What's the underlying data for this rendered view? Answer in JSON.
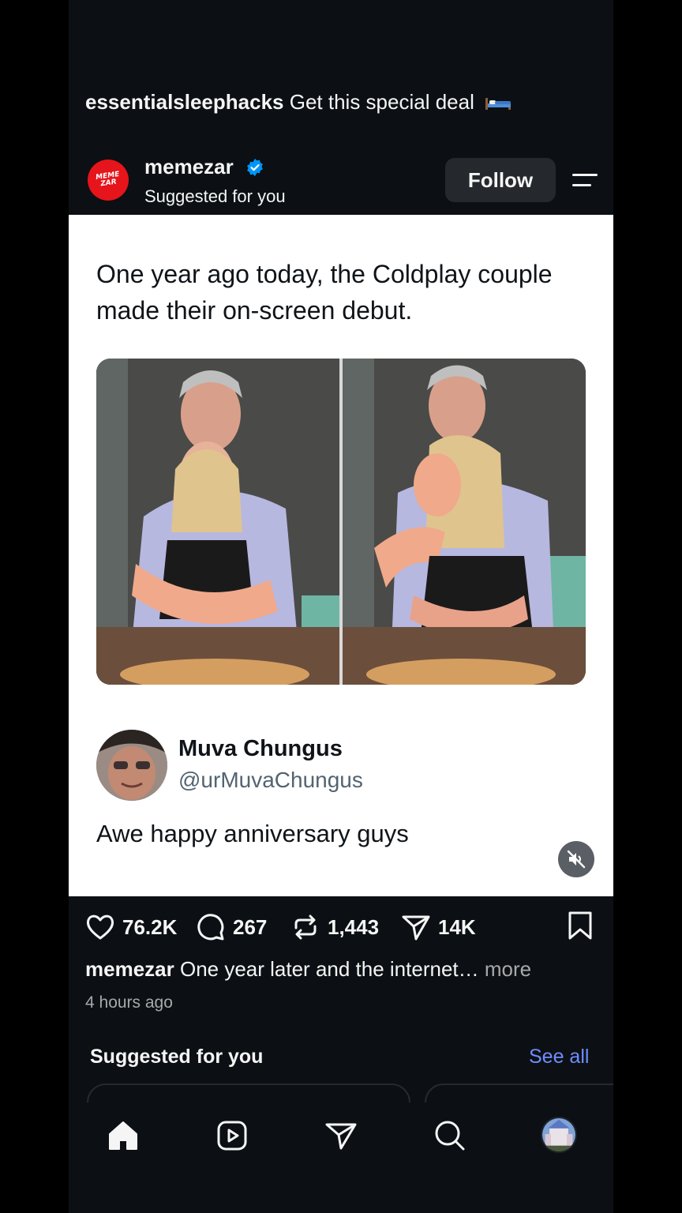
{
  "previous_post": {
    "username": "essentialsleephacks",
    "caption": "Get this special deal"
  },
  "post": {
    "username": "memezar",
    "avatar_text": "MEME ZAR",
    "subtitle": "Suggested for you",
    "follow_label": "Follow",
    "tweet_text": "One year ago today, the Coldplay couple made their on-screen debut.",
    "reply": {
      "name": "Muva Chungus",
      "handle": "@urMuvaChungus",
      "text": "Awe happy anniversary guys"
    },
    "likes": "76.2K",
    "comments": "267",
    "reposts": "1,443",
    "shares": "14K",
    "caption_user": "memezar",
    "caption_text": "One year later and the internet…",
    "more_label": "more",
    "timestamp": "4 hours ago"
  },
  "suggested": {
    "title": "Suggested for you",
    "see_all": "See all"
  },
  "colors": {
    "background": "#0c1014",
    "accent_link": "#708dff",
    "verified": "#0095f6",
    "brand_red": "#e6141b"
  },
  "icons": [
    "bed-icon",
    "verified-icon",
    "menu-icon",
    "mute-icon",
    "heart-icon",
    "comment-icon",
    "repost-icon",
    "share-icon",
    "save-icon",
    "home-icon",
    "reels-icon",
    "send-icon",
    "search-icon"
  ]
}
